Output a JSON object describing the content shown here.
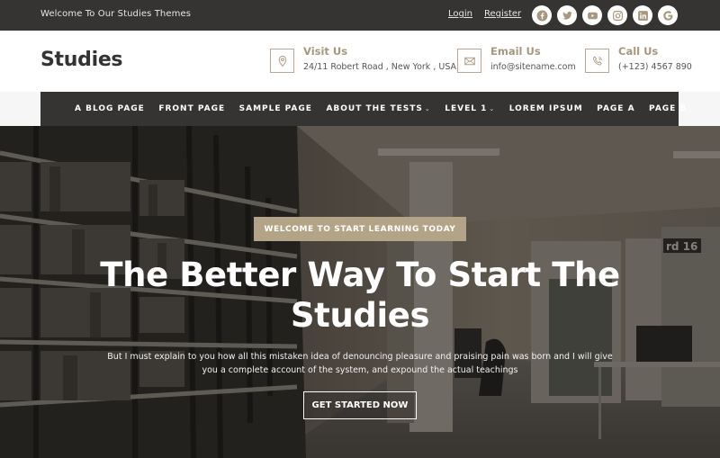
{
  "topbar": {
    "welcome_text": "Welcome To Our Studies Themes",
    "login_label": "Login",
    "register_label": "Register",
    "socials": [
      {
        "name": "facebook",
        "icon": "facebook-icon"
      },
      {
        "name": "twitter",
        "icon": "twitter-icon"
      },
      {
        "name": "youtube",
        "icon": "youtube-icon"
      },
      {
        "name": "instagram",
        "icon": "instagram-icon"
      },
      {
        "name": "linkedin",
        "icon": "linkedin-icon"
      },
      {
        "name": "google",
        "icon": "google-icon"
      }
    ]
  },
  "header": {
    "logo": "Studies",
    "visit": {
      "title": "Visit Us",
      "text": "24/11 Robert Road , New York , USA",
      "icon": "map-pin-icon"
    },
    "email": {
      "title": "Email Us",
      "text": "info@sitename.com",
      "icon": "envelope-icon"
    },
    "call": {
      "title": "Call Us",
      "text": "(+123) 4567 890",
      "icon": "phone-icon"
    }
  },
  "nav": {
    "items": [
      {
        "label": "A BLOG PAGE",
        "dropdown": false
      },
      {
        "label": "FRONT PAGE",
        "dropdown": false
      },
      {
        "label": "SAMPLE PAGE",
        "dropdown": false
      },
      {
        "label": "ABOUT THE TESTS",
        "dropdown": true
      },
      {
        "label": "LEVEL 1",
        "dropdown": true
      },
      {
        "label": "LOREM IPSUM",
        "dropdown": false
      },
      {
        "label": "PAGE A",
        "dropdown": false
      },
      {
        "label": "PAGE B",
        "dropdown": false
      }
    ],
    "caret": "⌄"
  },
  "hero": {
    "badge": "WELCOME TO START LEARNING TODAY",
    "headline": "The Better Way To Start The Studies",
    "description": "But I must explain to you how all this mistaken idea of denouncing pleasure and praising pain was born and I will give you a complete account of the system, and expound the actual teachings",
    "cta_label": "GET STARTED NOW",
    "background": "library-bookshelves-and-study-room-photo",
    "sign_text": "rd 16"
  },
  "colors": {
    "accent": "#b4a487",
    "dark": "#353433",
    "icon_tan": "#b8a792"
  }
}
